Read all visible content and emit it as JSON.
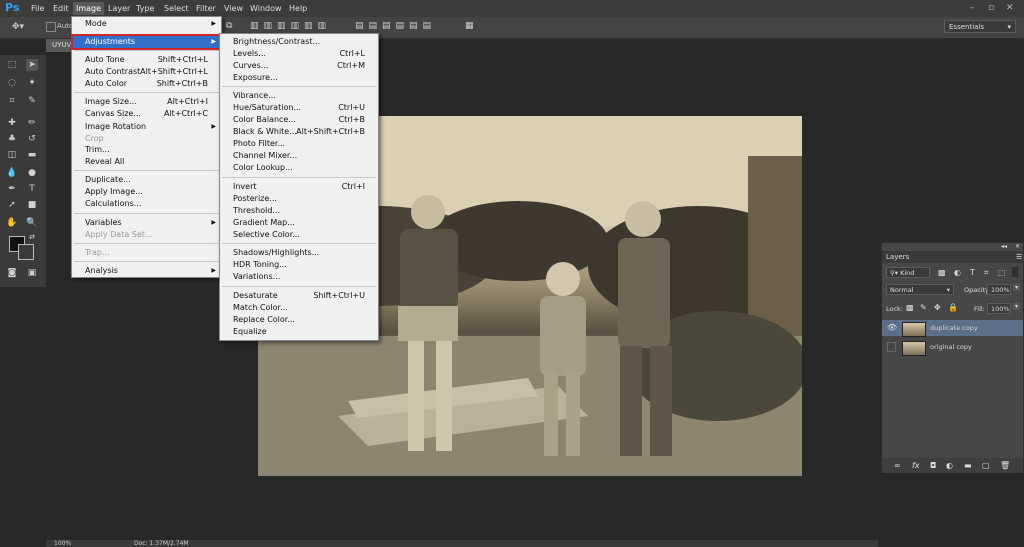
{
  "menubar": {
    "logo": "Ps",
    "items": [
      "File",
      "Edit",
      "Image",
      "Layer",
      "Type",
      "Select",
      "Filter",
      "View",
      "Window",
      "Help"
    ],
    "window_controls": [
      "–",
      "▫",
      "✕"
    ]
  },
  "options": {
    "workspace": "Essentials",
    "fragment": "Auto"
  },
  "document": {
    "tab": "UYUV"
  },
  "image_menu": {
    "items": [
      {
        "label": "Mode",
        "shortcut": "",
        "submenu": true
      },
      {
        "label": "Adjustments",
        "shortcut": "",
        "submenu": true
      },
      {
        "label": "Auto Tone",
        "shortcut": "Shift+Ctrl+L"
      },
      {
        "label": "Auto Contrast",
        "shortcut": "Alt+Shift+Ctrl+L"
      },
      {
        "label": "Auto Color",
        "shortcut": "Shift+Ctrl+B"
      },
      {
        "label": "Image Size...",
        "shortcut": "Alt+Ctrl+I"
      },
      {
        "label": "Canvas Size...",
        "shortcut": "Alt+Ctrl+C"
      },
      {
        "label": "Image Rotation",
        "shortcut": "",
        "submenu": true
      },
      {
        "label": "Crop",
        "shortcut": "",
        "disabled": true
      },
      {
        "label": "Trim...",
        "shortcut": ""
      },
      {
        "label": "Reveal All",
        "shortcut": ""
      },
      {
        "label": "Duplicate...",
        "shortcut": ""
      },
      {
        "label": "Apply Image...",
        "shortcut": ""
      },
      {
        "label": "Calculations...",
        "shortcut": ""
      },
      {
        "label": "Variables",
        "shortcut": "",
        "submenu": true
      },
      {
        "label": "Apply Data Set...",
        "shortcut": "",
        "disabled": true
      },
      {
        "label": "Trap...",
        "shortcut": "",
        "disabled": true
      },
      {
        "label": "Analysis",
        "shortcut": "",
        "submenu": true
      }
    ]
  },
  "adjust_menu": {
    "items": [
      {
        "label": "Brightness/Contrast...",
        "shortcut": ""
      },
      {
        "label": "Levels...",
        "shortcut": "Ctrl+L"
      },
      {
        "label": "Curves...",
        "shortcut": "Ctrl+M"
      },
      {
        "label": "Exposure...",
        "shortcut": ""
      },
      {
        "label": "Vibrance...",
        "shortcut": ""
      },
      {
        "label": "Hue/Saturation...",
        "shortcut": "Ctrl+U"
      },
      {
        "label": "Color Balance...",
        "shortcut": "Ctrl+B"
      },
      {
        "label": "Black & White...",
        "shortcut": "Alt+Shift+Ctrl+B"
      },
      {
        "label": "Photo Filter...",
        "shortcut": ""
      },
      {
        "label": "Channel Mixer...",
        "shortcut": ""
      },
      {
        "label": "Color Lookup...",
        "shortcut": ""
      },
      {
        "label": "Invert",
        "shortcut": "Ctrl+I"
      },
      {
        "label": "Posterize...",
        "shortcut": ""
      },
      {
        "label": "Threshold...",
        "shortcut": ""
      },
      {
        "label": "Gradient Map...",
        "shortcut": ""
      },
      {
        "label": "Selective Color...",
        "shortcut": ""
      },
      {
        "label": "Shadows/Highlights...",
        "shortcut": ""
      },
      {
        "label": "HDR Toning...",
        "shortcut": ""
      },
      {
        "label": "Variations...",
        "shortcut": ""
      },
      {
        "label": "Desaturate",
        "shortcut": "Shift+Ctrl+U"
      },
      {
        "label": "Match Color...",
        "shortcut": ""
      },
      {
        "label": "Replace Color...",
        "shortcut": ""
      },
      {
        "label": "Equalize",
        "shortcut": ""
      }
    ]
  },
  "layers_panel": {
    "tab": "Layers",
    "kind_label": "Kind",
    "blend_mode": "Normal",
    "opacity_label": "Opacity:",
    "opacity": "100%",
    "lock_label": "Lock:",
    "fill_label": "Fill:",
    "fill": "100%",
    "layers": [
      {
        "name": "duplicate copy",
        "selected": true,
        "visible": true
      },
      {
        "name": "original copy",
        "selected": false,
        "visible": false
      }
    ]
  },
  "status": {
    "zoom": "100%",
    "doc": "Doc: 1.37M/2.74M"
  }
}
